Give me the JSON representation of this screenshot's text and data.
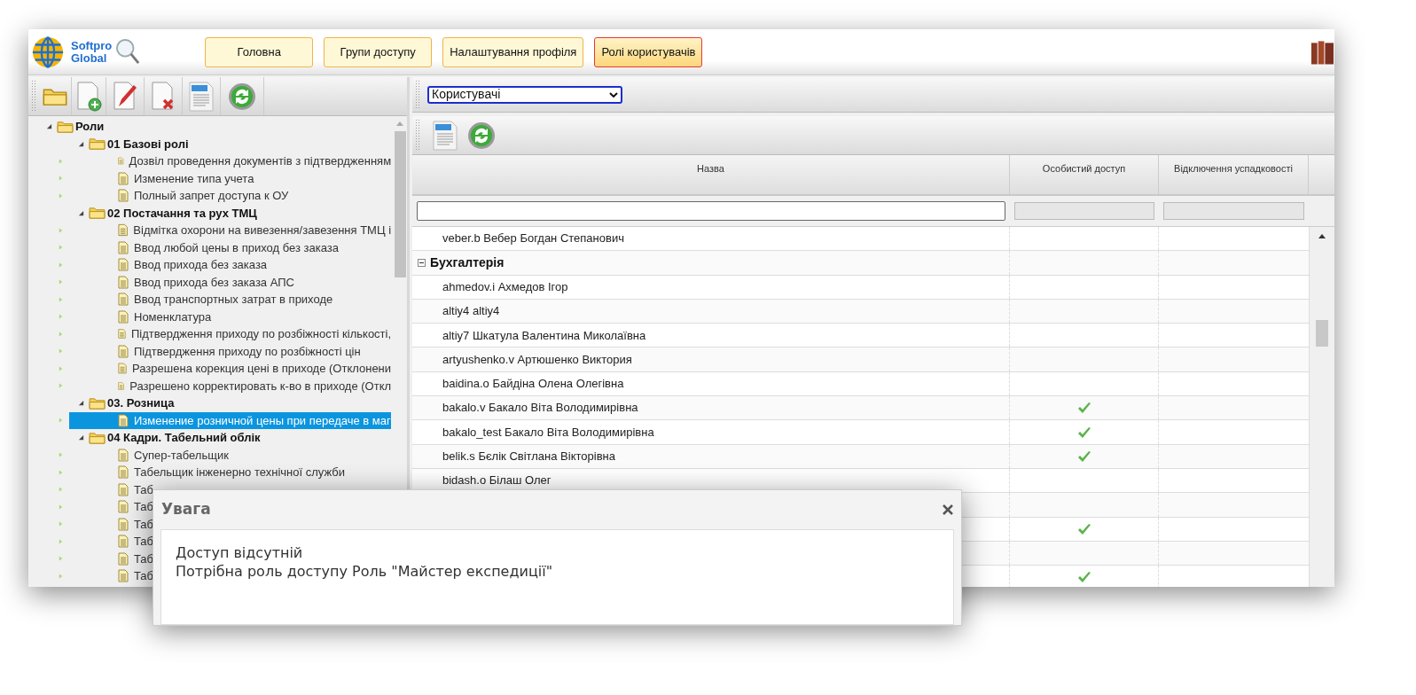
{
  "header": {
    "logo_lines": [
      "Softpro",
      "Global"
    ],
    "nav": [
      {
        "label": "Головна",
        "selected": false
      },
      {
        "label": "Групи доступу",
        "selected": false
      },
      {
        "label": "Налаштування профіля",
        "selected": false
      },
      {
        "label": "Ролі користувачів",
        "selected": true
      }
    ]
  },
  "tree": [
    {
      "label": "Роли",
      "expanded": true,
      "children": [
        {
          "label": "01 Базові ролі",
          "expanded": true,
          "children": [
            {
              "label": "Дозвіл проведення документів з підтвердженням",
              "selected": false
            },
            {
              "label": "Изменение типа учета",
              "selected": false
            },
            {
              "label": "Полный запрет доступа к ОУ",
              "selected": false
            }
          ]
        },
        {
          "label": "02 Постачання та рух ТМЦ",
          "expanded": true,
          "children": [
            {
              "label": "Відмітка охорони на вивезення/завезення ТМЦ і",
              "selected": false
            },
            {
              "label": "Ввод любой цены в приход без заказа",
              "selected": false
            },
            {
              "label": "Ввод прихода без заказа",
              "selected": false
            },
            {
              "label": "Ввод прихода без заказа АПС",
              "selected": false
            },
            {
              "label": "Ввод транспортных затрат в приходе",
              "selected": false
            },
            {
              "label": "Номенклатура",
              "selected": false
            },
            {
              "label": "Підтвердження приходу по розбіжності кількості,",
              "selected": false
            },
            {
              "label": "Підтвердження приходу по розбіжності цін",
              "selected": false
            },
            {
              "label": "Разрешена корекция ценi в приходе (Отклонени",
              "selected": false
            },
            {
              "label": "Разрешено корректировать к-во в приходе (Откл",
              "selected": false
            }
          ]
        },
        {
          "label": "03. Розница",
          "expanded": true,
          "children": [
            {
              "label": "Изменение розничной цены при передаче в маг",
              "selected": true
            }
          ]
        },
        {
          "label": "04 Кадри. Табельний облік",
          "expanded": true,
          "children": [
            {
              "label": "Супер-табельщик",
              "selected": false
            },
            {
              "label": "Табельщик інженерно технічної служби",
              "selected": false
            },
            {
              "label": "Таб",
              "selected": false
            },
            {
              "label": "Таб",
              "selected": false
            },
            {
              "label": "Таб",
              "selected": false
            },
            {
              "label": "Таб",
              "selected": false
            },
            {
              "label": "Таб",
              "selected": false
            },
            {
              "label": "Таб",
              "selected": false
            }
          ]
        }
      ]
    }
  ],
  "view_select": {
    "value": "Користувачі"
  },
  "grid": {
    "columns": [
      "Назва",
      "Особистий доступ",
      "Відключення успадковості"
    ],
    "rows": [
      {
        "kind": "user",
        "name": "veber.b Вебер Богдан Степанович",
        "personal_access": false
      },
      {
        "kind": "group",
        "name": "Бухгалтерія",
        "expanded": true
      },
      {
        "kind": "user",
        "name": "ahmedov.i Ахмедов Ігор",
        "personal_access": false
      },
      {
        "kind": "user",
        "name": "altiy4 altiy4",
        "personal_access": false
      },
      {
        "kind": "user",
        "name": "altiy7 Шкатула Валентина Миколаївна",
        "personal_access": false
      },
      {
        "kind": "user",
        "name": "artyushenko.v Артюшенко Виктория",
        "personal_access": false
      },
      {
        "kind": "user",
        "name": "baidina.o Байдіна Олена Олегівна",
        "personal_access": false
      },
      {
        "kind": "user",
        "name": "bakalo.v Бакало Віта Володимирівна",
        "personal_access": true
      },
      {
        "kind": "user",
        "name": "bakalo_test Бакало Віта Володимирівна",
        "personal_access": true
      },
      {
        "kind": "user",
        "name": "belik.s Бєлік Світлана Вікторівна",
        "personal_access": true
      },
      {
        "kind": "user",
        "name": "bidash.o Білаш Олег",
        "personal_access": false
      },
      {
        "kind": "user",
        "personal_access": false
      },
      {
        "kind": "user",
        "personal_access": true
      },
      {
        "kind": "user",
        "personal_access": false
      },
      {
        "kind": "user",
        "personal_access": true
      }
    ]
  },
  "dialog": {
    "title": "Увага",
    "lines": [
      "Доступ відсутній",
      "Потрібна роль доступу Роль \"Майстер експедиції\""
    ]
  }
}
